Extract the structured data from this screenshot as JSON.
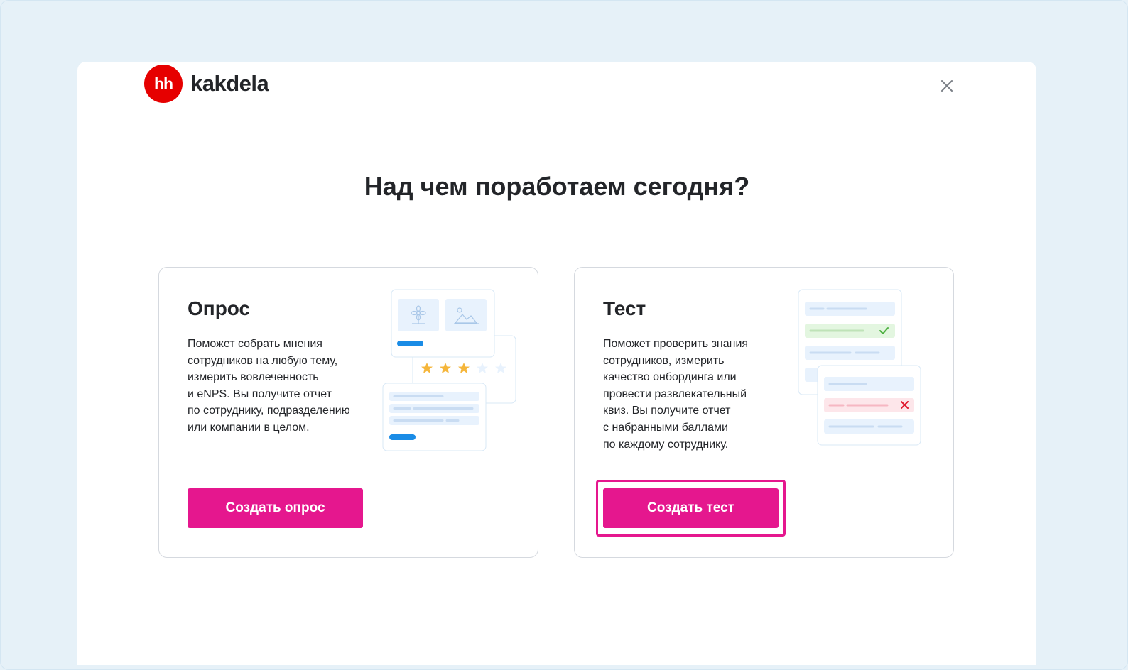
{
  "logo": {
    "badge": "hh",
    "name": "kakdela"
  },
  "modal": {
    "heading": "Над чем поработаем сегодня?"
  },
  "cards": [
    {
      "title": "Опрос",
      "description": "Поможет собрать мнения\nсотрудников на любую тему,\nизмерить вовлеченность\nи eNPS. Вы получите отчет\nпо сотруднику, подразделению\nили компании в целом.",
      "button_label": "Создать опрос",
      "illustration": "survey-illustration",
      "stars_filled": 3,
      "stars_total": 5
    },
    {
      "title": "Тест",
      "description": "Поможет проверить знания\nсотрудников, измерить\nкачество онбординга или\nпровести развлекательный\nквиз. Вы получите отчет\nс набранными баллами\nпо каждому сотруднику.",
      "button_label": "Создать тест",
      "illustration": "quiz-illustration",
      "focused": true
    }
  ],
  "colors": {
    "accent": "#e5178e",
    "logo_red": "#e60000",
    "backdrop": "#e6f1f8",
    "star": "#f5b63b",
    "correct": "#4caf3f",
    "wrong": "#e0182d"
  },
  "icons": {
    "close": "close-icon"
  }
}
